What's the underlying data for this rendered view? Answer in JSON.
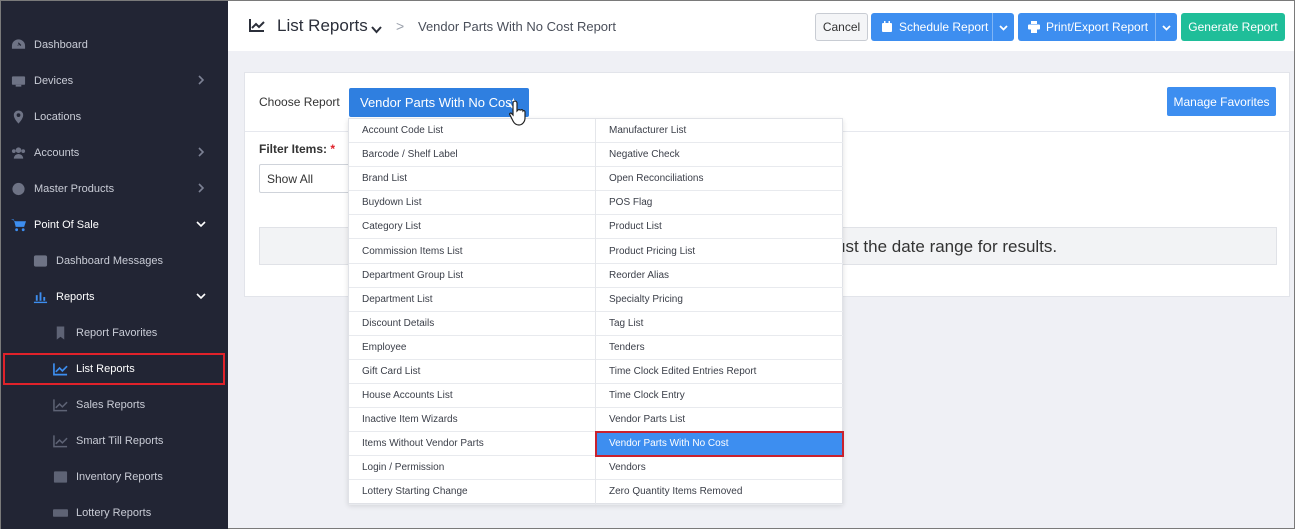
{
  "sidebar": {
    "items": [
      {
        "label": "Dashboard"
      },
      {
        "label": "Devices"
      },
      {
        "label": "Locations"
      },
      {
        "label": "Accounts"
      },
      {
        "label": "Master Products"
      },
      {
        "label": "Point Of Sale"
      },
      {
        "label": "Dashboard Messages"
      },
      {
        "label": "Reports"
      },
      {
        "label": "Report Favorites"
      },
      {
        "label": "List Reports"
      },
      {
        "label": "Sales Reports"
      },
      {
        "label": "Smart Till Reports"
      },
      {
        "label": "Inventory Reports"
      },
      {
        "label": "Lottery Reports"
      }
    ]
  },
  "header": {
    "title": "List Reports",
    "separator": ">",
    "breadcrumb": "Vendor Parts With No Cost Report",
    "cancel_label": "Cancel",
    "schedule_label": "Schedule Report",
    "print_label": "Print/Export Report",
    "generate_label": "Generate Report"
  },
  "card": {
    "choose_label": "Choose Report",
    "selected_report": "Vendor Parts With No Cost",
    "manage_label": "Manage Favorites",
    "filter_label": "Filter Items:",
    "filter_required": "*",
    "filter_value": "Show All",
    "message": "ust the date range for results."
  },
  "dropdown": {
    "left": [
      "Account Code List",
      "Barcode / Shelf Label",
      "Brand List",
      "Buydown List",
      "Category List",
      "Commission Items List",
      "Department Group List",
      "Department List",
      "Discount Details",
      "Employee",
      "Gift Card List",
      "House Accounts List",
      "Inactive Item Wizards",
      "Items Without Vendor Parts",
      "Login / Permission",
      "Lottery Starting Change"
    ],
    "right": [
      "Manufacturer List",
      "Negative Check",
      "Open Reconciliations",
      "POS Flag",
      "Product List",
      "Product Pricing List",
      "Reorder Alias",
      "Specialty Pricing",
      "Tag List",
      "Tenders",
      "Time Clock Edited Entries Report",
      "Time Clock Entry",
      "Vendor Parts List",
      "Vendor Parts With No Cost",
      "Vendors",
      "Zero Quantity Items Removed"
    ],
    "selected": "Vendor Parts With No Cost"
  },
  "colors": {
    "sidebar_bg": "#222534",
    "accent_blue": "#3d8ef0",
    "generate_green": "#1fbe99",
    "highlight_red": "#e0222a"
  }
}
